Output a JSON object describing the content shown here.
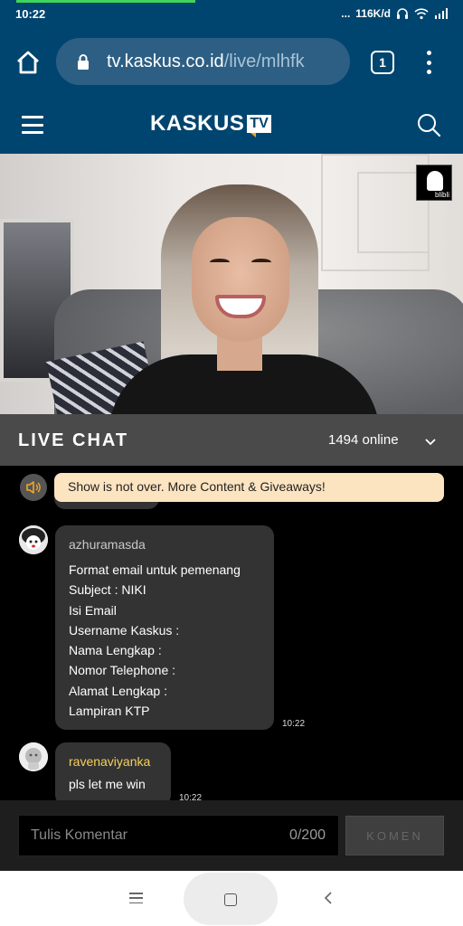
{
  "status_bar": {
    "time": "10:22",
    "network_speed": "116K/d",
    "dots": "..."
  },
  "browser": {
    "url_host": "tv.kaskus.co.id",
    "url_path": "/live/mlhfk",
    "tab_count": "1"
  },
  "site_header": {
    "logo_text": "KASKUS",
    "logo_badge": "TV"
  },
  "video": {
    "badge_text": "blibli"
  },
  "live_chat": {
    "title": "LIVE CHAT",
    "online_count": "1494 online",
    "announcement": "Show is not over. More Content & Giveaways!",
    "messages": [
      {
        "username": "azhuramasda",
        "lines": [
          "Format email untuk pemenang",
          "Subject : NIKI",
          "Isi Email",
          "Username Kaskus :",
          "Nama Lengkap :",
          "Nomor Telephone :",
          "Alamat Lengkap :",
          "Lampiran KTP"
        ],
        "time": "10:22"
      },
      {
        "username": "ravenaviyanka",
        "lines": [
          "pls let me win"
        ],
        "time": "10:22"
      }
    ]
  },
  "comment": {
    "placeholder": "Tulis Komentar",
    "counter": "0/200",
    "send_label": "KOMEN"
  },
  "colors": {
    "brand_blue": "#00456f",
    "announcement_bg": "#fce4c0",
    "username_highlight": "#f5d15a"
  }
}
